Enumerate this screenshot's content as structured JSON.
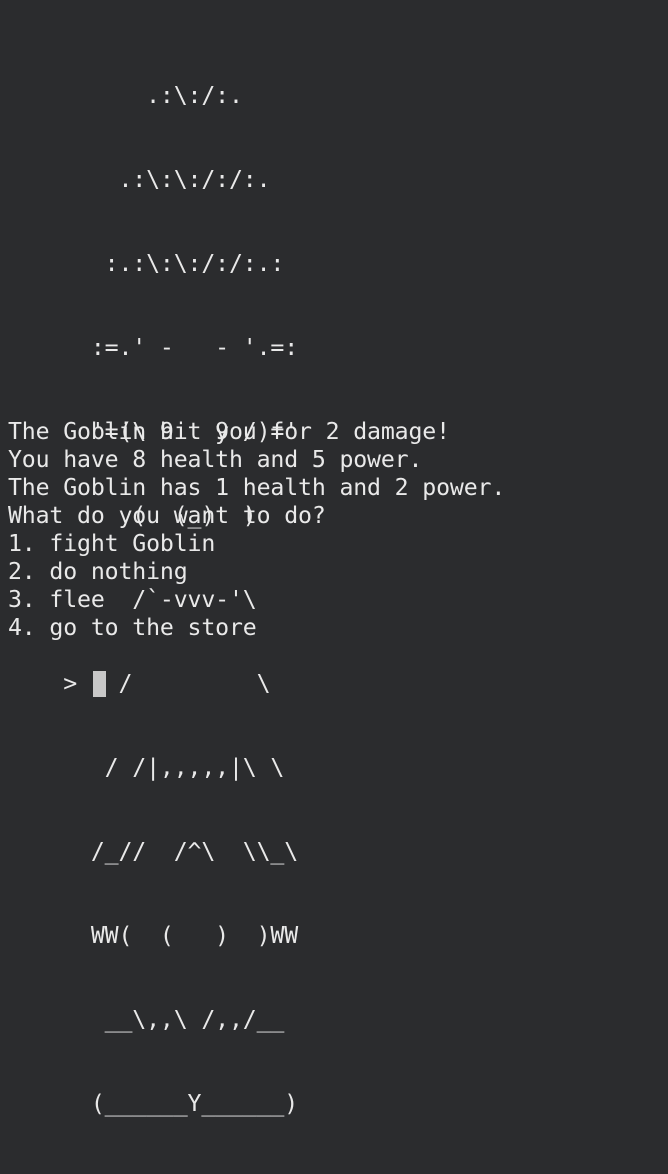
{
  "ascii_art": [
    "          .:\\:/:.",
    "        .:\\:\\:/:/:.",
    "       :.:\\:\\:/:/:.:",
    "      :=.' -   - '.=:",
    "      '=(\\ 9   9 /)='",
    "         (  (_)  )",
    "         /`-vvv-'\\",
    "        /         \\",
    "       / /|,,,,,|\\ \\",
    "      /_//  /^\\  \\\\_\\",
    "      WW(  (   )  )WW",
    "       __\\,,\\ /,,/__",
    "      (______Y______)"
  ],
  "output_lines": [
    "The Goblin hit you for 2 damage!",
    "You have 8 health and 5 power.",
    "The Goblin has 1 health and 2 power.",
    "What do you want to do?",
    "1. fight Goblin",
    "2. do nothing",
    "3. flee",
    "4. go to the store"
  ],
  "prompt": ">"
}
